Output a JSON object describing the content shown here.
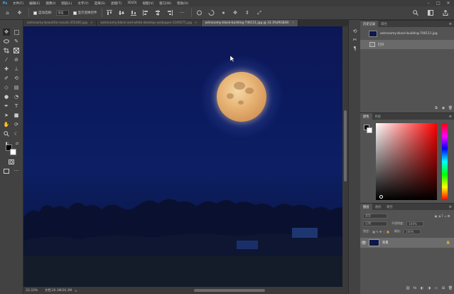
{
  "app": {
    "logo": "Ps"
  },
  "menu": [
    "文件(F)",
    "编辑(E)",
    "图像(I)",
    "图层(L)",
    "文字(Y)",
    "选择(S)",
    "滤镜(T)",
    "3D(D)",
    "视图(V)",
    "窗口(W)",
    "帮助(H)"
  ],
  "window_controls": {
    "minimize": "–",
    "maximize": "□",
    "close": "✕"
  },
  "options": {
    "home": "⌂",
    "move": "✥",
    "auto_select_label": "自动选择:",
    "auto_select_value": "图层",
    "show_transform_label": "显示变换控件"
  },
  "tabs": [
    {
      "label": "astronomy-beautiful-clouds-355465.jpg",
      "close": "×"
    },
    {
      "label": "astronomy-black-and-white-desktop-wallpaper-1169575.jpg",
      "close": "×"
    },
    {
      "label": "astronomy-black-building-746111.jpg @ 33.3%(RGB/8)",
      "close": "×"
    }
  ],
  "status": {
    "zoom": "33.33%",
    "doc": "文档:26.3M/26.3M",
    "arrow": ">"
  },
  "history_panel": {
    "tabs": [
      "历史记录",
      "属性"
    ],
    "menu": "≡",
    "snapshot_label": "astronomy-black-building-746111.jpg",
    "state_label": "打开",
    "buttons": [
      "⧉",
      "◉",
      "🗑"
    ]
  },
  "color_panel": {
    "tabs": [
      "颜色",
      "色板"
    ],
    "menu": "≡",
    "fg": "#000000",
    "bg": "#ffffff"
  },
  "layers_panel": {
    "tabs": [
      "图层",
      "通道",
      "路径"
    ],
    "menu": "≡",
    "kind_label": "类型",
    "blend_mode": "正常",
    "opacity_label": "不透明度:",
    "opacity_value": "100%",
    "lock_label": "锁定:",
    "fill_label": "填充:",
    "fill_value": "100%",
    "layer_name": "背景",
    "eye": "👁",
    "lock": "🔒",
    "buttons": [
      "⛓",
      "fx",
      "◐",
      "◑",
      "▭",
      "⊞",
      "🗑"
    ]
  },
  "colors": {
    "accent": "#31a8ff",
    "night_sky": "#0c1756",
    "moon": "#e9b87a"
  }
}
